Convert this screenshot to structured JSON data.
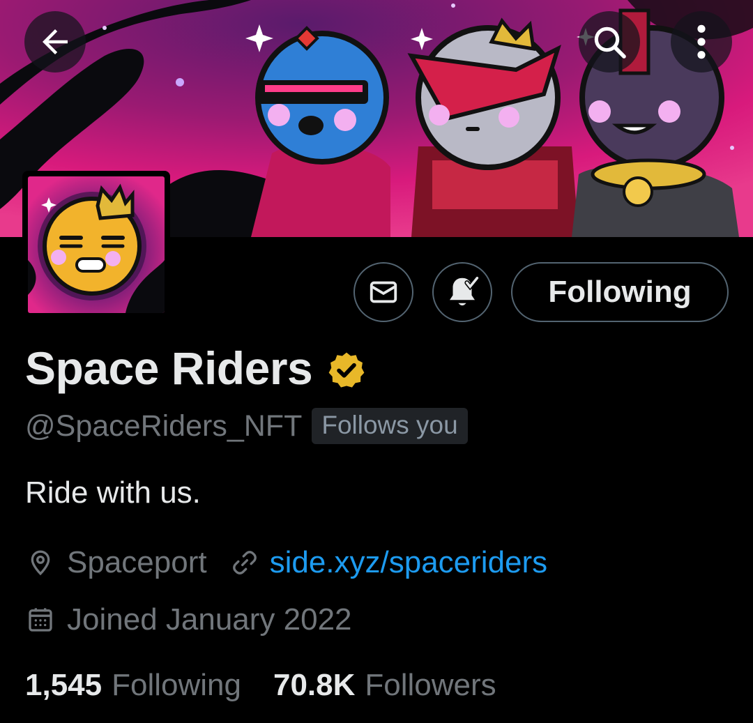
{
  "header": {
    "back_icon": "arrow-left-icon",
    "search_icon": "search-icon",
    "more_icon": "more-vertical-icon"
  },
  "actions": {
    "message_icon": "envelope-icon",
    "notify_icon": "bell-check-icon",
    "follow_label": "Following"
  },
  "profile": {
    "name": "Space Riders",
    "verified_badge": "gold-verified-badge",
    "handle": "@SpaceRiders_NFT",
    "follows_you": "Follows you",
    "bio": "Ride with us.",
    "location": "Spaceport",
    "website": "side.xyz/spaceriders",
    "joined": "Joined January 2022"
  },
  "stats": {
    "following_count": "1,545",
    "following_label": "Following",
    "followers_count": "70.8K",
    "followers_label": "Followers"
  },
  "colors": {
    "background": "#000000",
    "text_primary": "#e7e9ea",
    "text_secondary": "#71767b",
    "link": "#1d9bf0",
    "banner_magenta": "#d81a7c",
    "banner_purple": "#3a0f4a",
    "badge_gold": "#e8b829"
  }
}
